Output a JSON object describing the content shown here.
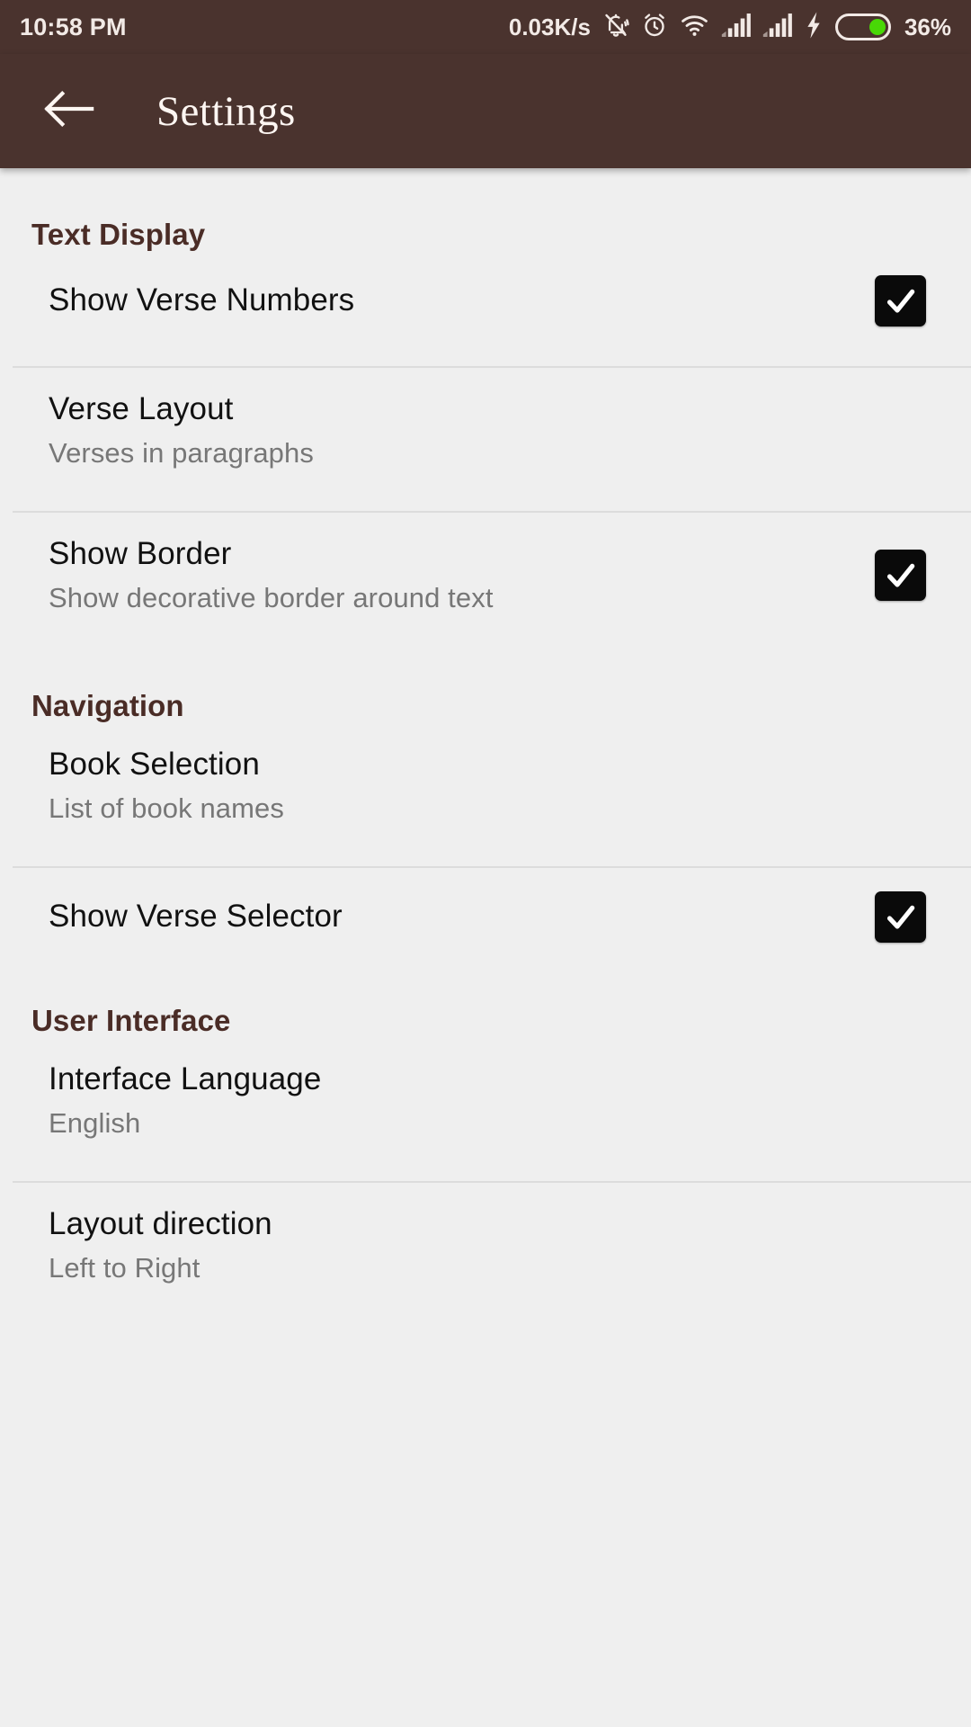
{
  "status_bar": {
    "time": "10:58 PM",
    "network_speed": "0.03K/s",
    "battery_percent": "36%",
    "icons": [
      "bell-muted-icon",
      "alarm-clock-icon",
      "wifi-icon",
      "signal-bars-sim1-icon",
      "signal-bars-sim2-icon",
      "charging-bolt-icon",
      "battery-icon"
    ],
    "battery_level": 36,
    "colors": {
      "background": "#4a332e",
      "foreground": "#f2eae6",
      "battery_fill": "#48d806"
    }
  },
  "app_bar": {
    "title": "Settings",
    "back_icon": "arrow-left-icon",
    "colors": {
      "background": "#4a332e",
      "title": "#fdf6f2"
    }
  },
  "theme": {
    "page_background": "#efefef",
    "section_header_color": "#4a2c26",
    "row_title_color": "#111111",
    "row_subtitle_color": "#777777",
    "divider_color": "#dcdcdc",
    "checkbox_color": "#0a0a0a"
  },
  "sections": [
    {
      "header": "Text Display",
      "rows": [
        {
          "title": "Show Verse Numbers",
          "subtitle": null,
          "control": "checkbox",
          "checked": true
        },
        {
          "title": "Verse Layout",
          "subtitle": "Verses in paragraphs",
          "control": null,
          "checked": null
        },
        {
          "title": "Show Border",
          "subtitle": "Show decorative border around text",
          "control": "checkbox",
          "checked": true
        }
      ]
    },
    {
      "header": "Navigation",
      "rows": [
        {
          "title": "Book Selection",
          "subtitle": "List of book names",
          "control": null,
          "checked": null
        },
        {
          "title": "Show Verse Selector",
          "subtitle": null,
          "control": "checkbox",
          "checked": true
        }
      ]
    },
    {
      "header": "User Interface",
      "rows": [
        {
          "title": "Interface Language",
          "subtitle": "English",
          "control": null,
          "checked": null
        },
        {
          "title": "Layout direction",
          "subtitle": "Left to Right",
          "control": null,
          "checked": null
        }
      ]
    }
  ]
}
